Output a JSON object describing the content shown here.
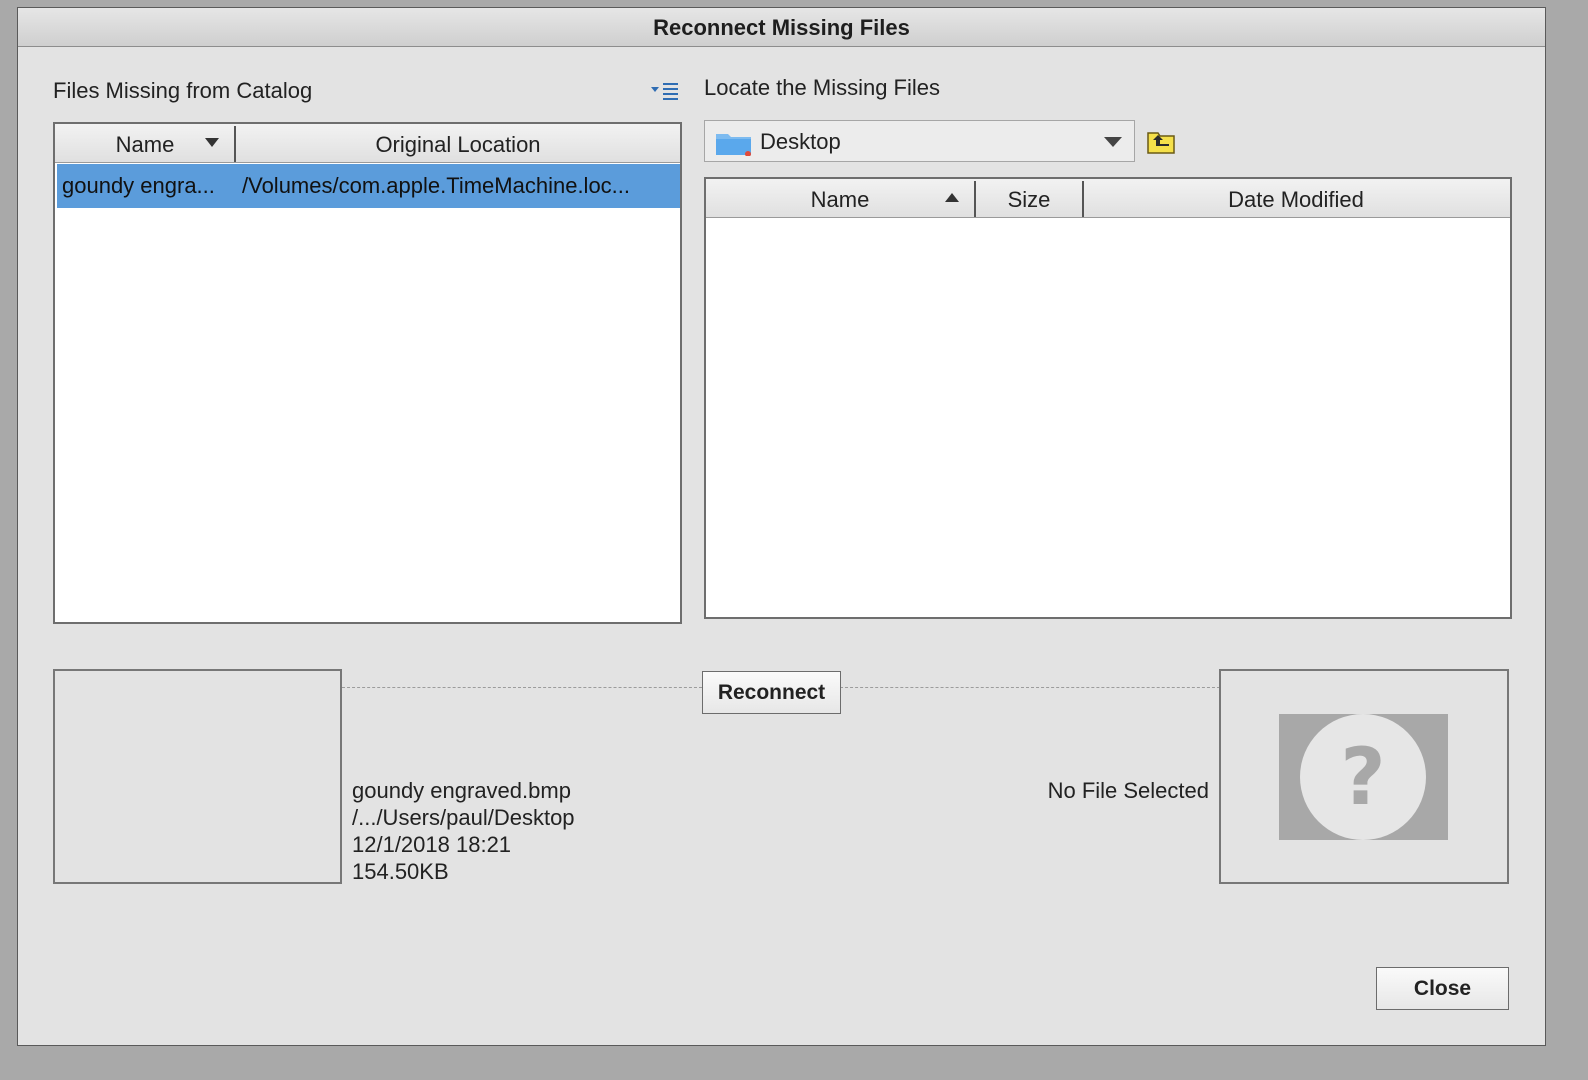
{
  "window": {
    "title": "Reconnect Missing Files"
  },
  "left_panel": {
    "label": "Files Missing from Catalog",
    "menu_icon": "list-options-icon",
    "columns": [
      "Name",
      "Original Location"
    ],
    "rows": [
      {
        "name": "goundy engra...",
        "location": "/Volumes/com.apple.TimeMachine.loc...",
        "selected": true
      }
    ],
    "selected_color": "#5b9cdb"
  },
  "right_panel": {
    "label": "Locate the Missing Files",
    "folder_dropdown": {
      "value": "Desktop",
      "icon": "folder-icon"
    },
    "up_folder_icon": "up-folder-icon",
    "columns": [
      "Name",
      "Size",
      "Date Modified"
    ],
    "rows": []
  },
  "selected_file_info": {
    "filename": "goundy engraved.bmp",
    "path": "/.../Users/paul/Desktop",
    "date": "12/1/2018 18:21",
    "size": "154.50KB"
  },
  "reconnect_button": "Reconnect",
  "no_file_label": "No File Selected",
  "close_button": "Close",
  "question_mark": "?"
}
